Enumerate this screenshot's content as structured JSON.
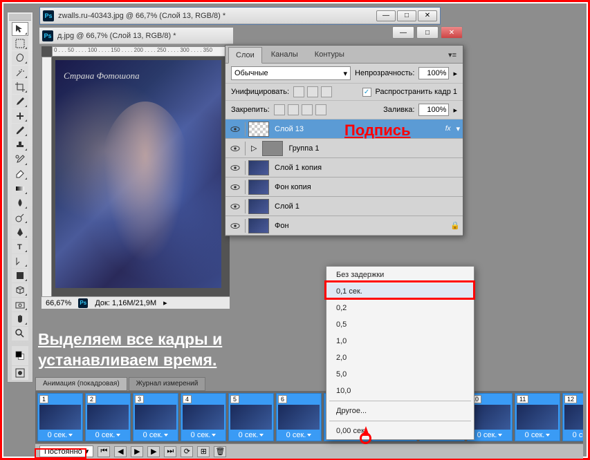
{
  "app": {
    "main_title": "zwalls.ru-40343.jpg @ 66,7% (Слой 13, RGB/8) *",
    "doc2_title": "д.jpg @ 66,7% (Слой 13, RGB/8) *",
    "zoom": "66,67%",
    "doc_info": "Док: 1,16M/21,9M",
    "watermark": "Страна Фотошопа"
  },
  "layers_panel": {
    "tabs": [
      "Слои",
      "Каналы",
      "Контуры"
    ],
    "blend_mode": "Обычные",
    "opacity_label": "Непрозрачность:",
    "opacity_val": "100%",
    "unify_label": "Унифицировать:",
    "propagate_label": "Распространить кадр 1",
    "lock_label": "Закрепить:",
    "fill_label": "Заливка:",
    "fill_val": "100%",
    "layers": [
      {
        "name": "Слой 13",
        "sel": true,
        "fx": true,
        "thumb": "trans"
      },
      {
        "name": "Группа 1",
        "folder": true
      },
      {
        "name": "Слой 1 копия"
      },
      {
        "name": "Фон копия"
      },
      {
        "name": "Слой 1"
      },
      {
        "name": "Фон",
        "locked": true
      }
    ]
  },
  "delay_menu": {
    "items": [
      "Без задержки",
      "0,1 сек.",
      "0,2",
      "0,5",
      "1,0",
      "2,0",
      "5,0",
      "10,0"
    ],
    "other": "Другое...",
    "current": "0,00 сек."
  },
  "animation": {
    "tab1": "Анимация (покадровая)",
    "tab2": "Журнал измерений",
    "frame_time": "0 сек.",
    "loop": "Постоянно",
    "frame_count": 12
  },
  "annotations": {
    "signature": "Подпись",
    "main_text": "Выделяем все кадры и\nустанавливаем время."
  },
  "ruler_h": "0 . . . 50 . . . . 100 . . . . 150 . . . . 200 . . . . 250 . . . . 300 . . . . 350"
}
